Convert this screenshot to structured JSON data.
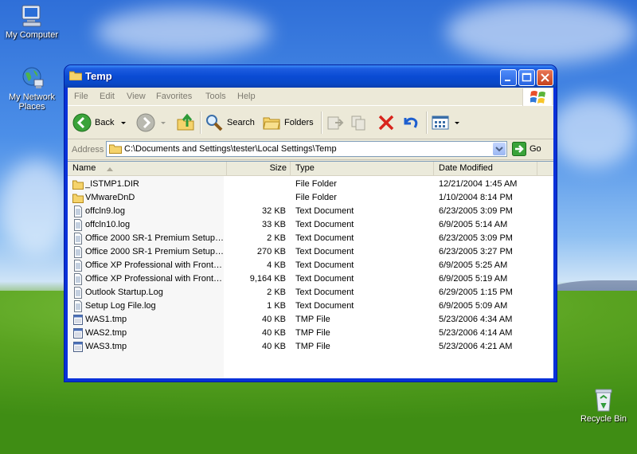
{
  "desktop": {
    "icons": [
      {
        "label": "My Computer",
        "icon": "computer-icon"
      },
      {
        "label": "My Network Places",
        "icon": "network-icon"
      },
      {
        "label": "Recycle Bin",
        "icon": "recycle-bin-icon"
      }
    ]
  },
  "window": {
    "title": "Temp",
    "menu": [
      "File",
      "Edit",
      "View",
      "Favorites",
      "Tools",
      "Help"
    ],
    "toolbar": {
      "back_label": "Back",
      "search_label": "Search",
      "folders_label": "Folders"
    },
    "address": {
      "label": "Address",
      "value": "C:\\Documents and Settings\\tester\\Local Settings\\Temp",
      "go_label": "Go"
    },
    "columns": {
      "name": "Name",
      "size": "Size",
      "type": "Type",
      "date": "Date Modified"
    },
    "files": [
      {
        "name": "_ISTMP1.DIR",
        "size": "",
        "type": "File Folder",
        "date": "12/21/2004 1:45 AM",
        "icon": "folder-icon"
      },
      {
        "name": "VMwareDnD",
        "size": "",
        "type": "File Folder",
        "date": "1/10/2004 8:14 PM",
        "icon": "folder-icon"
      },
      {
        "name": "offcln9.log",
        "size": "32 KB",
        "type": "Text Document",
        "date": "6/23/2005 3:09 PM",
        "icon": "text-document-icon"
      },
      {
        "name": "offcln10.log",
        "size": "33 KB",
        "type": "Text Document",
        "date": "6/9/2005 5:14 AM",
        "icon": "text-document-icon"
      },
      {
        "name": "Office 2000 SR-1 Premium Setup(…",
        "size": "2 KB",
        "type": "Text Document",
        "date": "6/23/2005 3:09 PM",
        "icon": "text-document-icon"
      },
      {
        "name": "Office 2000 SR-1 Premium Setup(…",
        "size": "270 KB",
        "type": "Text Document",
        "date": "6/23/2005 3:27 PM",
        "icon": "text-document-icon"
      },
      {
        "name": "Office XP Professional with FrontP…",
        "size": "4 KB",
        "type": "Text Document",
        "date": "6/9/2005 5:25 AM",
        "icon": "text-document-icon"
      },
      {
        "name": "Office XP Professional with FrontP…",
        "size": "9,164 KB",
        "type": "Text Document",
        "date": "6/9/2005 5:19 AM",
        "icon": "text-document-icon"
      },
      {
        "name": "Outlook Startup.Log",
        "size": "2 KB",
        "type": "Text Document",
        "date": "6/29/2005 1:15 PM",
        "icon": "text-document-icon"
      },
      {
        "name": "Setup Log File.log",
        "size": "1 KB",
        "type": "Text Document",
        "date": "6/9/2005 5:09 AM",
        "icon": "text-document-icon"
      },
      {
        "name": "WAS1.tmp",
        "size": "40 KB",
        "type": "TMP File",
        "date": "5/23/2006 4:34 AM",
        "icon": "tmp-file-icon"
      },
      {
        "name": "WAS2.tmp",
        "size": "40 KB",
        "type": "TMP File",
        "date": "5/23/2006 4:14 AM",
        "icon": "tmp-file-icon"
      },
      {
        "name": "WAS3.tmp",
        "size": "40 KB",
        "type": "TMP File",
        "date": "5/23/2006 4:21 AM",
        "icon": "tmp-file-icon"
      }
    ]
  }
}
